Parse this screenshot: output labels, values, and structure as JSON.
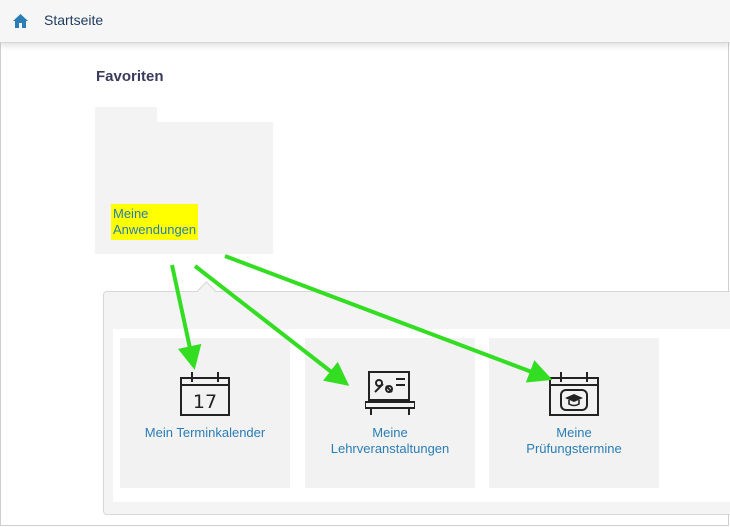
{
  "header": {
    "home_icon": "home-icon",
    "title": "Startseite"
  },
  "favorites": {
    "heading": "Favoriten",
    "tile": {
      "label_line1": "Meine",
      "label_line2": "Anwendungen",
      "highlight_color": "#ffff00"
    }
  },
  "applications": [
    {
      "icon": "calendar-icon",
      "icon_text": "17",
      "line1": "Mein Terminkalender",
      "line2": ""
    },
    {
      "icon": "lecture-icon",
      "line1": "Meine",
      "line2": "Lehrveranstaltungen"
    },
    {
      "icon": "exam-calendar-icon",
      "line1": "Meine",
      "line2": "Prüfungstermine"
    }
  ],
  "colors": {
    "link": "#2a7db5",
    "arrow": "#33dd22",
    "heading": "#3a3a5c"
  }
}
